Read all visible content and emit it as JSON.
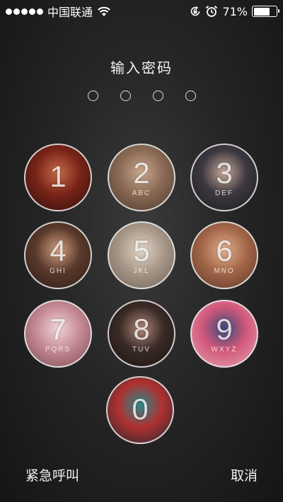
{
  "status_bar": {
    "carrier": "中国联通",
    "battery_percent": "71%",
    "battery_level": 0.71
  },
  "lock": {
    "title": "输入密码",
    "entered_digits": 0
  },
  "keypad": [
    {
      "digit": "1",
      "letters": "",
      "colors": [
        "#7a2418",
        "#c46a4a",
        "#2a0f0a"
      ]
    },
    {
      "digit": "2",
      "letters": "ABC",
      "colors": [
        "#8b6a55",
        "#c9a88f",
        "#4a3a30"
      ]
    },
    {
      "digit": "3",
      "letters": "DEF",
      "colors": [
        "#3d3840",
        "#c8a99a",
        "#1a1a1e"
      ]
    },
    {
      "digit": "4",
      "letters": "GHI",
      "colors": [
        "#5a3a2c",
        "#d4a083",
        "#2b1c16"
      ]
    },
    {
      "digit": "5",
      "letters": "JKL",
      "colors": [
        "#a89889",
        "#e3d6c7",
        "#6e6258"
      ]
    },
    {
      "digit": "6",
      "letters": "MNO",
      "colors": [
        "#a4674a",
        "#e0b08e",
        "#5b3728"
      ]
    },
    {
      "digit": "7",
      "letters": "PQRS",
      "colors": [
        "#c58a95",
        "#efd4d8",
        "#7a4a50"
      ]
    },
    {
      "digit": "8",
      "letters": "TUV",
      "colors": [
        "#3a2a26",
        "#b08878",
        "#1b1312"
      ]
    },
    {
      "digit": "9",
      "letters": "WXYZ",
      "colors": [
        "#d2587a",
        "#3a4a7a",
        "#e5a5b4"
      ]
    },
    {
      "digit": "0",
      "letters": "",
      "colors": [
        "#b03030",
        "#2a8a8a",
        "#1c2a30"
      ]
    }
  ],
  "footer": {
    "emergency_label": "紧急呼叫",
    "cancel_label": "取消"
  }
}
